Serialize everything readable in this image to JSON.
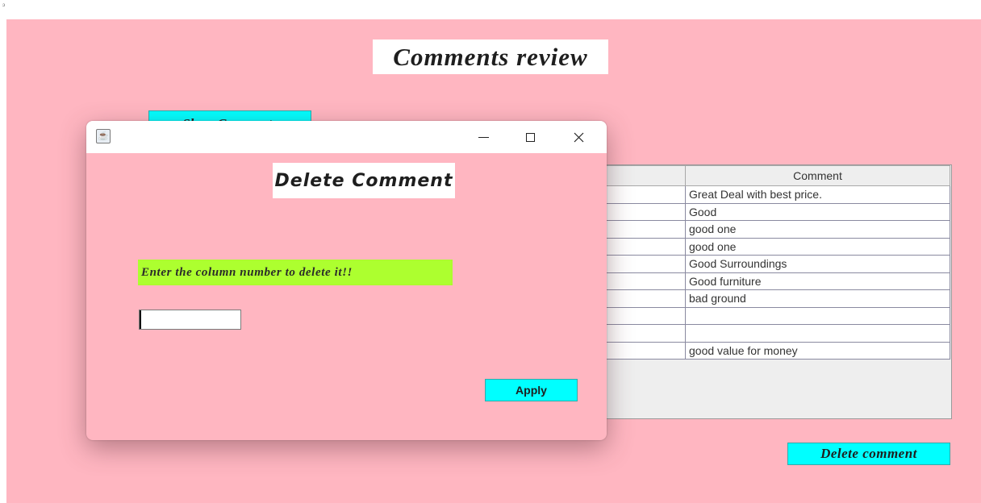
{
  "main": {
    "title": "Comments review",
    "show_comments_label": "Show Comments",
    "delete_comment_label": "Delete comment",
    "table": {
      "columns": [
        "",
        "Comment"
      ],
      "rows": [
        [
          "",
          "Great Deal with best price."
        ],
        [
          "",
          "Good"
        ],
        [
          "",
          "good one"
        ],
        [
          "",
          "good one"
        ],
        [
          "",
          "Good Surroundings"
        ],
        [
          "",
          "Good furniture"
        ],
        [
          "",
          "bad ground"
        ],
        [
          "",
          ""
        ],
        [
          "",
          ""
        ],
        [
          "",
          "good value for money"
        ]
      ]
    }
  },
  "dialog": {
    "title": "Delete Comment",
    "prompt": "Enter the column number to delete it!!",
    "input_value": "",
    "apply_label": "Apply",
    "icons": {
      "app": "java-icon",
      "minimize": "minimize-icon",
      "maximize": "maximize-icon",
      "close": "close-icon"
    }
  },
  "colors": {
    "background": "#ffb6c1",
    "button": "#00ffff",
    "label_highlight": "#adff2f",
    "title_bg": "#ffffff"
  }
}
